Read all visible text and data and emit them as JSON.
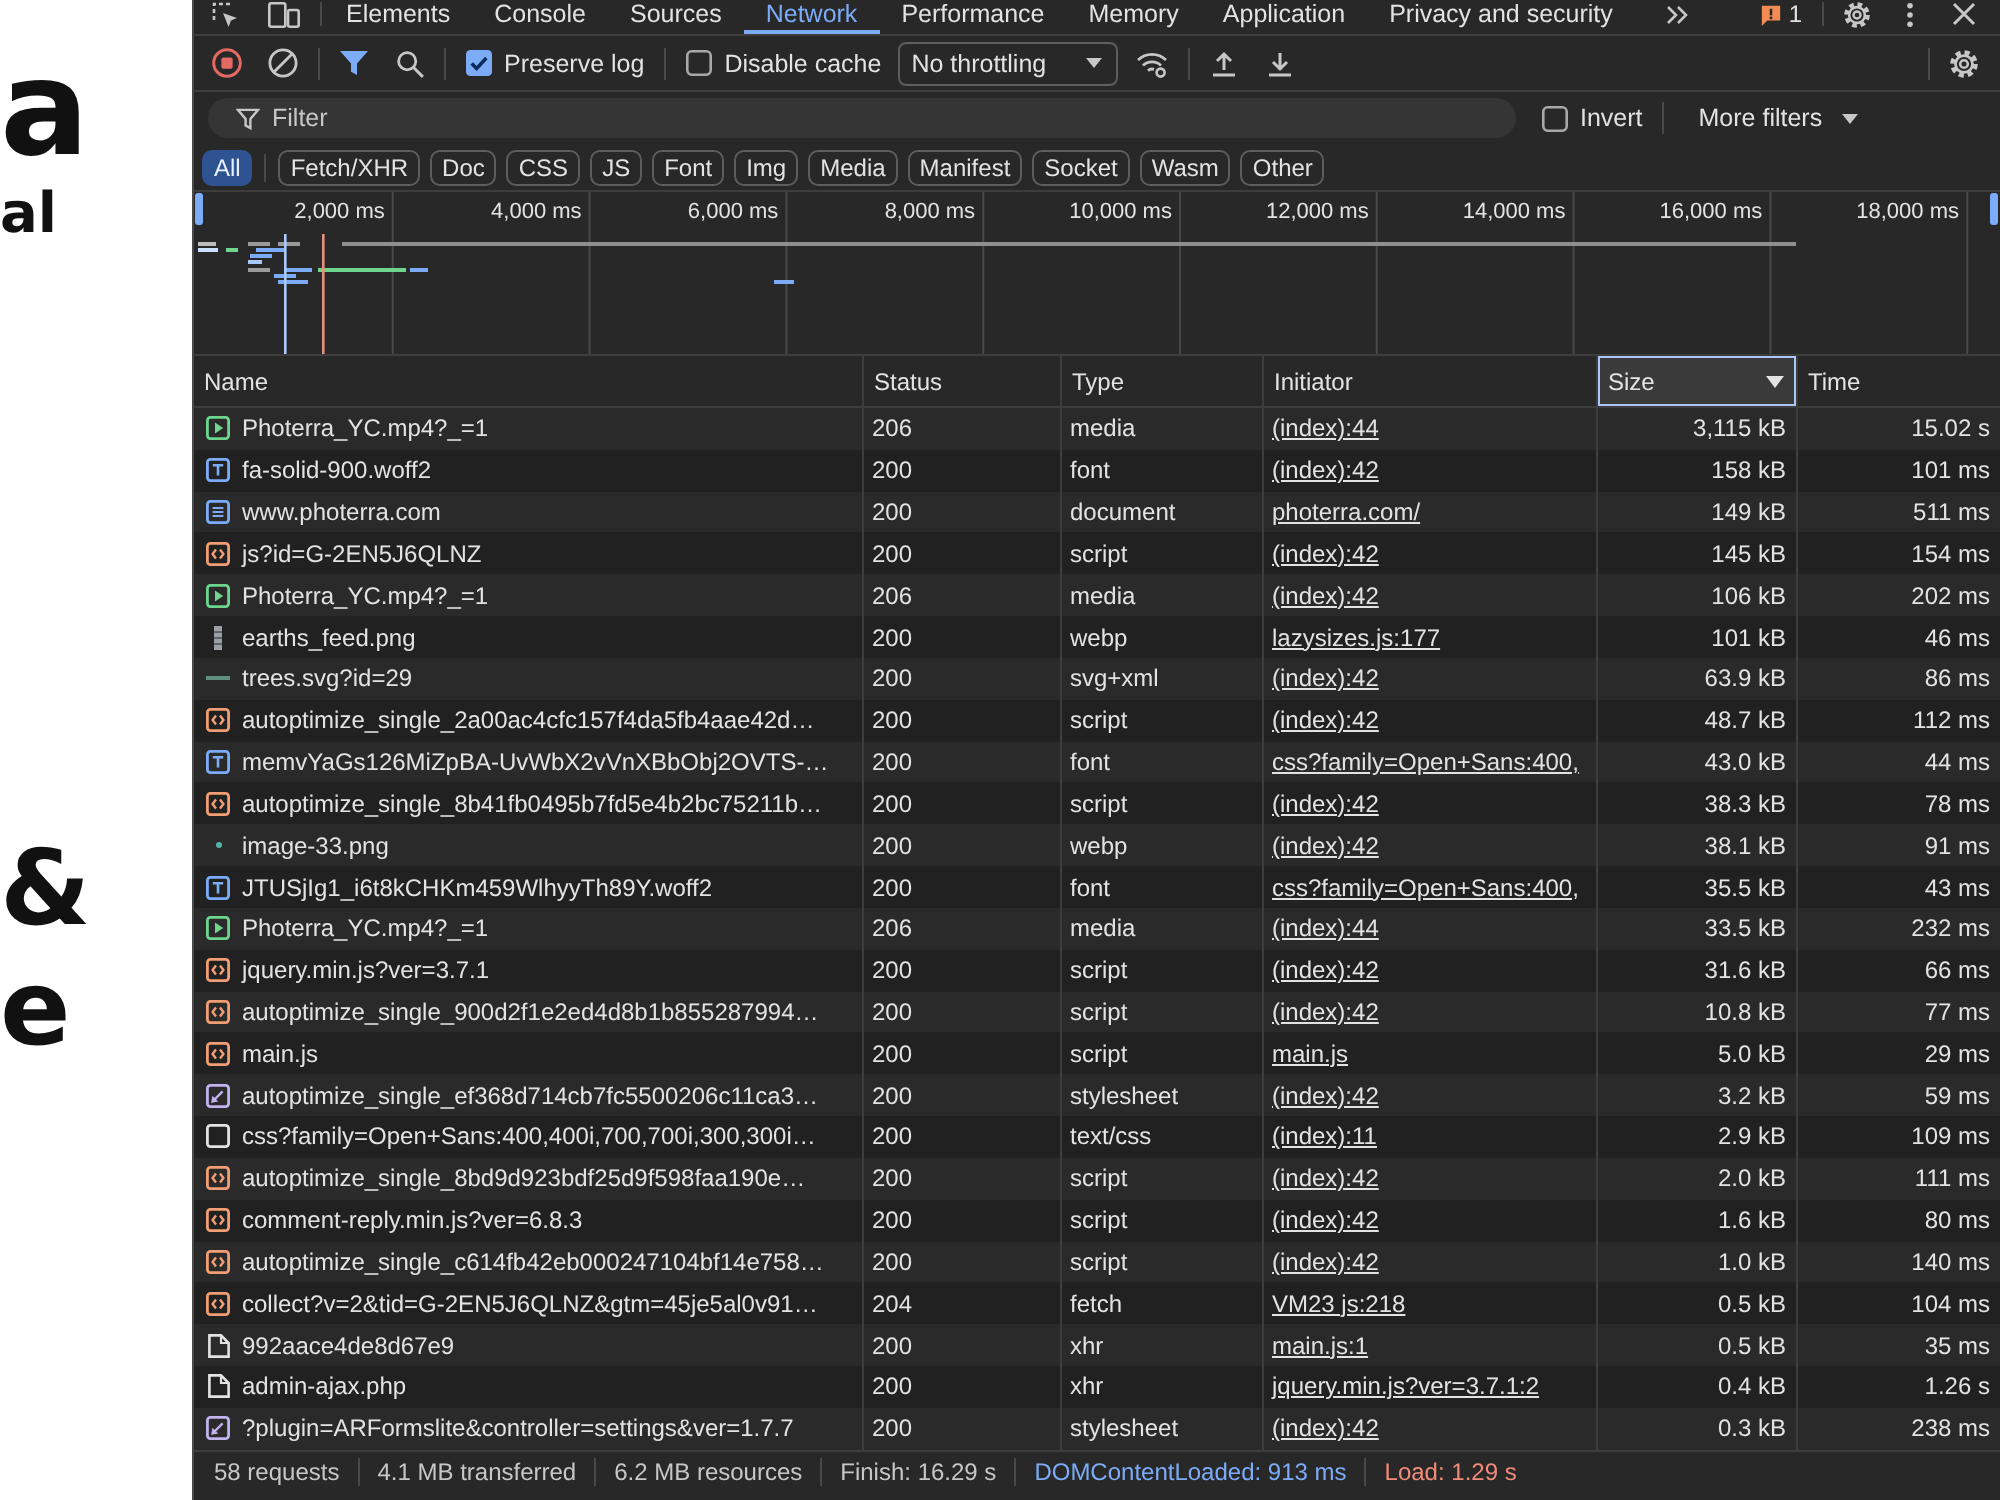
{
  "page_behind": {
    "title": "a",
    "subtitle": "al",
    "heading_lines": [
      "&",
      "e"
    ]
  },
  "devtools": {
    "panel_tabs": [
      {
        "label": "Elements",
        "selected": false
      },
      {
        "label": "Console",
        "selected": false
      },
      {
        "label": "Sources",
        "selected": false
      },
      {
        "label": "Network",
        "selected": true
      },
      {
        "label": "Performance",
        "selected": false
      },
      {
        "label": "Memory",
        "selected": false
      },
      {
        "label": "Application",
        "selected": false
      },
      {
        "label": "Privacy and security",
        "selected": false
      }
    ],
    "issues_count": "1",
    "toolbar": {
      "recording": true,
      "preserve_log": {
        "label": "Preserve log",
        "checked": true
      },
      "disable_cache": {
        "label": "Disable cache",
        "checked": false
      },
      "throttling": "No throttling"
    },
    "filter": {
      "placeholder": "Filter",
      "invert": {
        "label": "Invert",
        "checked": false
      },
      "more_filters": "More filters"
    },
    "type_filters": [
      {
        "label": "All",
        "selected": true
      },
      {
        "label": "Fetch/XHR",
        "selected": false
      },
      {
        "label": "Doc",
        "selected": false
      },
      {
        "label": "CSS",
        "selected": false
      },
      {
        "label": "JS",
        "selected": false
      },
      {
        "label": "Font",
        "selected": false
      },
      {
        "label": "Img",
        "selected": false
      },
      {
        "label": "Media",
        "selected": false
      },
      {
        "label": "Manifest",
        "selected": false
      },
      {
        "label": "Socket",
        "selected": false
      },
      {
        "label": "Wasm",
        "selected": false
      },
      {
        "label": "Other",
        "selected": false
      }
    ],
    "timeline": {
      "ticks": [
        "2,000 ms",
        "4,000 ms",
        "6,000 ms",
        "8,000 ms",
        "10,000 ms",
        "12,000 ms",
        "14,000 ms",
        "16,000 ms",
        "18,000 ms"
      ]
    },
    "table": {
      "columns": [
        {
          "label": "Name",
          "sorted": false
        },
        {
          "label": "Status",
          "sorted": false
        },
        {
          "label": "Type",
          "sorted": false
        },
        {
          "label": "Initiator",
          "sorted": false
        },
        {
          "label": "Size",
          "sorted": true
        },
        {
          "label": "Time",
          "sorted": false
        }
      ],
      "rows": [
        {
          "kind": "media",
          "name": "Photerra_YC.mp4?_=1",
          "status": "206",
          "type": "media",
          "initiator": "(index):44",
          "size": "3,115 kB",
          "time": "15.02 s"
        },
        {
          "kind": "font",
          "name": "fa-solid-900.woff2",
          "status": "200",
          "type": "font",
          "initiator": "(index):42",
          "size": "158 kB",
          "time": "101 ms"
        },
        {
          "kind": "document",
          "name": "www.photerra.com",
          "status": "200",
          "type": "document",
          "initiator": "photerra.com/",
          "size": "149 kB",
          "time": "511 ms"
        },
        {
          "kind": "script",
          "name": "js?id=G-2EN5J6QLNZ",
          "status": "200",
          "type": "script",
          "initiator": "(index):42",
          "size": "145 kB",
          "time": "154 ms"
        },
        {
          "kind": "media",
          "name": "Photerra_YC.mp4?_=1",
          "status": "206",
          "type": "media",
          "initiator": "(index):42",
          "size": "106 kB",
          "time": "202 ms"
        },
        {
          "kind": "photo",
          "name": "earths_feed.png",
          "status": "200",
          "type": "webp",
          "initiator": "lazysizes.js:177",
          "size": "101 kB",
          "time": "46 ms"
        },
        {
          "kind": "line",
          "name": "trees.svg?id=29",
          "status": "200",
          "type": "svg+xml",
          "initiator": "(index):42",
          "size": "63.9 kB",
          "time": "86 ms"
        },
        {
          "kind": "script",
          "name": "autoptimize_single_2a00ac4cfc157f4da5fb4aae42d…",
          "status": "200",
          "type": "script",
          "initiator": "(index):42",
          "size": "48.7 kB",
          "time": "112 ms"
        },
        {
          "kind": "font",
          "name": "memvYaGs126MiZpBA-UvWbX2vVnXBbObj2OVTS-…",
          "status": "200",
          "type": "font",
          "initiator": "css?family=Open+Sans:400,",
          "size": "43.0 kB",
          "time": "44 ms"
        },
        {
          "kind": "script",
          "name": "autoptimize_single_8b41fb0495b7fd5e4b2bc75211b…",
          "status": "200",
          "type": "script",
          "initiator": "(index):42",
          "size": "38.3 kB",
          "time": "78 ms"
        },
        {
          "kind": "dot",
          "name": "image-33.png",
          "status": "200",
          "type": "webp",
          "initiator": "(index):42",
          "size": "38.1 kB",
          "time": "91 ms"
        },
        {
          "kind": "font",
          "name": "JTUSjIg1_i6t8kCHKm459WlhyyTh89Y.woff2",
          "status": "200",
          "type": "font",
          "initiator": "css?family=Open+Sans:400,",
          "size": "35.5 kB",
          "time": "43 ms"
        },
        {
          "kind": "media",
          "name": "Photerra_YC.mp4?_=1",
          "status": "206",
          "type": "media",
          "initiator": "(index):44",
          "size": "33.5 kB",
          "time": "232 ms"
        },
        {
          "kind": "script",
          "name": "jquery.min.js?ver=3.7.1",
          "status": "200",
          "type": "script",
          "initiator": "(index):42",
          "size": "31.6 kB",
          "time": "66 ms"
        },
        {
          "kind": "script",
          "name": "autoptimize_single_900d2f1e2ed4d8b1b855287994…",
          "status": "200",
          "type": "script",
          "initiator": "(index):42",
          "size": "10.8 kB",
          "time": "77 ms"
        },
        {
          "kind": "script",
          "name": "main.js",
          "status": "200",
          "type": "script",
          "initiator": "main.js",
          "size": "5.0 kB",
          "time": "29 ms"
        },
        {
          "kind": "stylesheet",
          "name": "autoptimize_single_ef368d714cb7fc5500206c11ca3…",
          "status": "200",
          "type": "stylesheet",
          "initiator": "(index):42",
          "size": "3.2 kB",
          "time": "59 ms"
        },
        {
          "kind": "plain",
          "name": "css?family=Open+Sans:400,400i,700,700i,300,300i…",
          "status": "200",
          "type": "text/css",
          "initiator": "(index):11",
          "size": "2.9 kB",
          "time": "109 ms"
        },
        {
          "kind": "script",
          "name": "autoptimize_single_8bd9d923bdf25d9f598faa190e…",
          "status": "200",
          "type": "script",
          "initiator": "(index):42",
          "size": "2.0 kB",
          "time": "111 ms"
        },
        {
          "kind": "script",
          "name": "comment-reply.min.js?ver=6.8.3",
          "status": "200",
          "type": "script",
          "initiator": "(index):42",
          "size": "1.6 kB",
          "time": "80 ms"
        },
        {
          "kind": "script",
          "name": "autoptimize_single_c614fb42eb000247104bf14e758…",
          "status": "200",
          "type": "script",
          "initiator": "(index):42",
          "size": "1.0 kB",
          "time": "140 ms"
        },
        {
          "kind": "script",
          "name": "collect?v=2&tid=G-2EN5J6QLNZ&gtm=45je5al0v91…",
          "status": "204",
          "type": "fetch",
          "initiator": "VM23 js:218",
          "size": "0.5 kB",
          "time": "104 ms"
        },
        {
          "kind": "xhr",
          "name": "992aace4de8d67e9",
          "status": "200",
          "type": "xhr",
          "initiator": "main.js:1",
          "size": "0.5 kB",
          "time": "35 ms"
        },
        {
          "kind": "xhr",
          "name": "admin-ajax.php",
          "status": "200",
          "type": "xhr",
          "initiator": "jquery.min.js?ver=3.7.1:2",
          "size": "0.4 kB",
          "time": "1.26 s"
        },
        {
          "kind": "stylesheet",
          "name": "?plugin=ARFormslite&controller=settings&ver=1.7.7",
          "status": "200",
          "type": "stylesheet",
          "initiator": "(index):42",
          "size": "0.3 kB",
          "time": "238 ms"
        }
      ]
    },
    "status_bar": [
      {
        "text": "58 requests"
      },
      {
        "text": "4.1 MB transferred"
      },
      {
        "text": "6.2 MB resources"
      },
      {
        "text": "Finish: 16.29 s"
      },
      {
        "text": "DOMContentLoaded: 913 ms",
        "color": "#7cacf8"
      },
      {
        "text": "Load: 1.29 s",
        "color": "#f28b7a"
      }
    ]
  }
}
